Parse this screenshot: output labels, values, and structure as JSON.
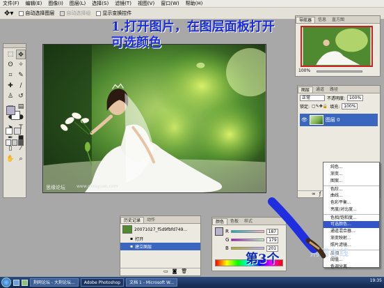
{
  "menubar": {
    "items": [
      "文件(F)",
      "编辑(E)",
      "图像(I)",
      "图层(L)",
      "选择(S)",
      "滤镜(T)",
      "视图(V)",
      "窗口(W)",
      "帮助(H)"
    ]
  },
  "options": {
    "auto_select_layer": "自动选择图层",
    "auto_select_group": "自动选择组",
    "show_transform": "显示变换控件"
  },
  "annotation": {
    "line1": "1.打开图片，在图层面板打开",
    "line2": "可选颜色"
  },
  "canvas": {
    "watermark": "思缘论坛",
    "watermark2": "www.missyuan.com"
  },
  "navigator": {
    "zoom": "100%",
    "tabs": [
      "导航器",
      "信息",
      "直方图"
    ]
  },
  "layers": {
    "tabs": [
      "图层",
      "通道",
      "路径"
    ],
    "blend_mode": "正常",
    "opacity_label": "不透明度:",
    "opacity_value": "100%",
    "lock_label": "锁定:",
    "fill_label": "填充:",
    "fill_value": "100%",
    "layer_name": "图层 0"
  },
  "history": {
    "tabs": [
      "历史记录",
      "动作"
    ],
    "snapshot": "20071027_f5d9fbfd749...",
    "items": [
      "打开",
      "建立图层"
    ]
  },
  "color_panel": {
    "tabs": [
      "颜色",
      "色板",
      "样式"
    ],
    "r": "187",
    "g": "179",
    "b": "201"
  },
  "adjust_menu": {
    "items": [
      "纯色...",
      "渐变...",
      "图案...",
      "色阶...",
      "曲线...",
      "色彩平衡...",
      "亮度/对比度...",
      "色相/饱和度...",
      "可选颜色...",
      "通道混合器...",
      "渐变映射...",
      "照片滤镜...",
      "反相",
      "阈值...",
      "色调分离..."
    ],
    "highlighted_index": 8
  },
  "step": {
    "label": "第3个"
  },
  "logo": {
    "text": "荆网在线"
  },
  "taskbar": {
    "buttons": [
      "荆网论坛 - 大荆论坛...",
      "Adobe Photoshop",
      "文档 1 - Microsoft W..."
    ],
    "clock": "19:35"
  },
  "colors": {
    "accent_blue": "#1a2de0",
    "selection": "#3a66c0",
    "menu_highlight": "#3355cc",
    "fg_swatch": "#b8b3cc"
  }
}
